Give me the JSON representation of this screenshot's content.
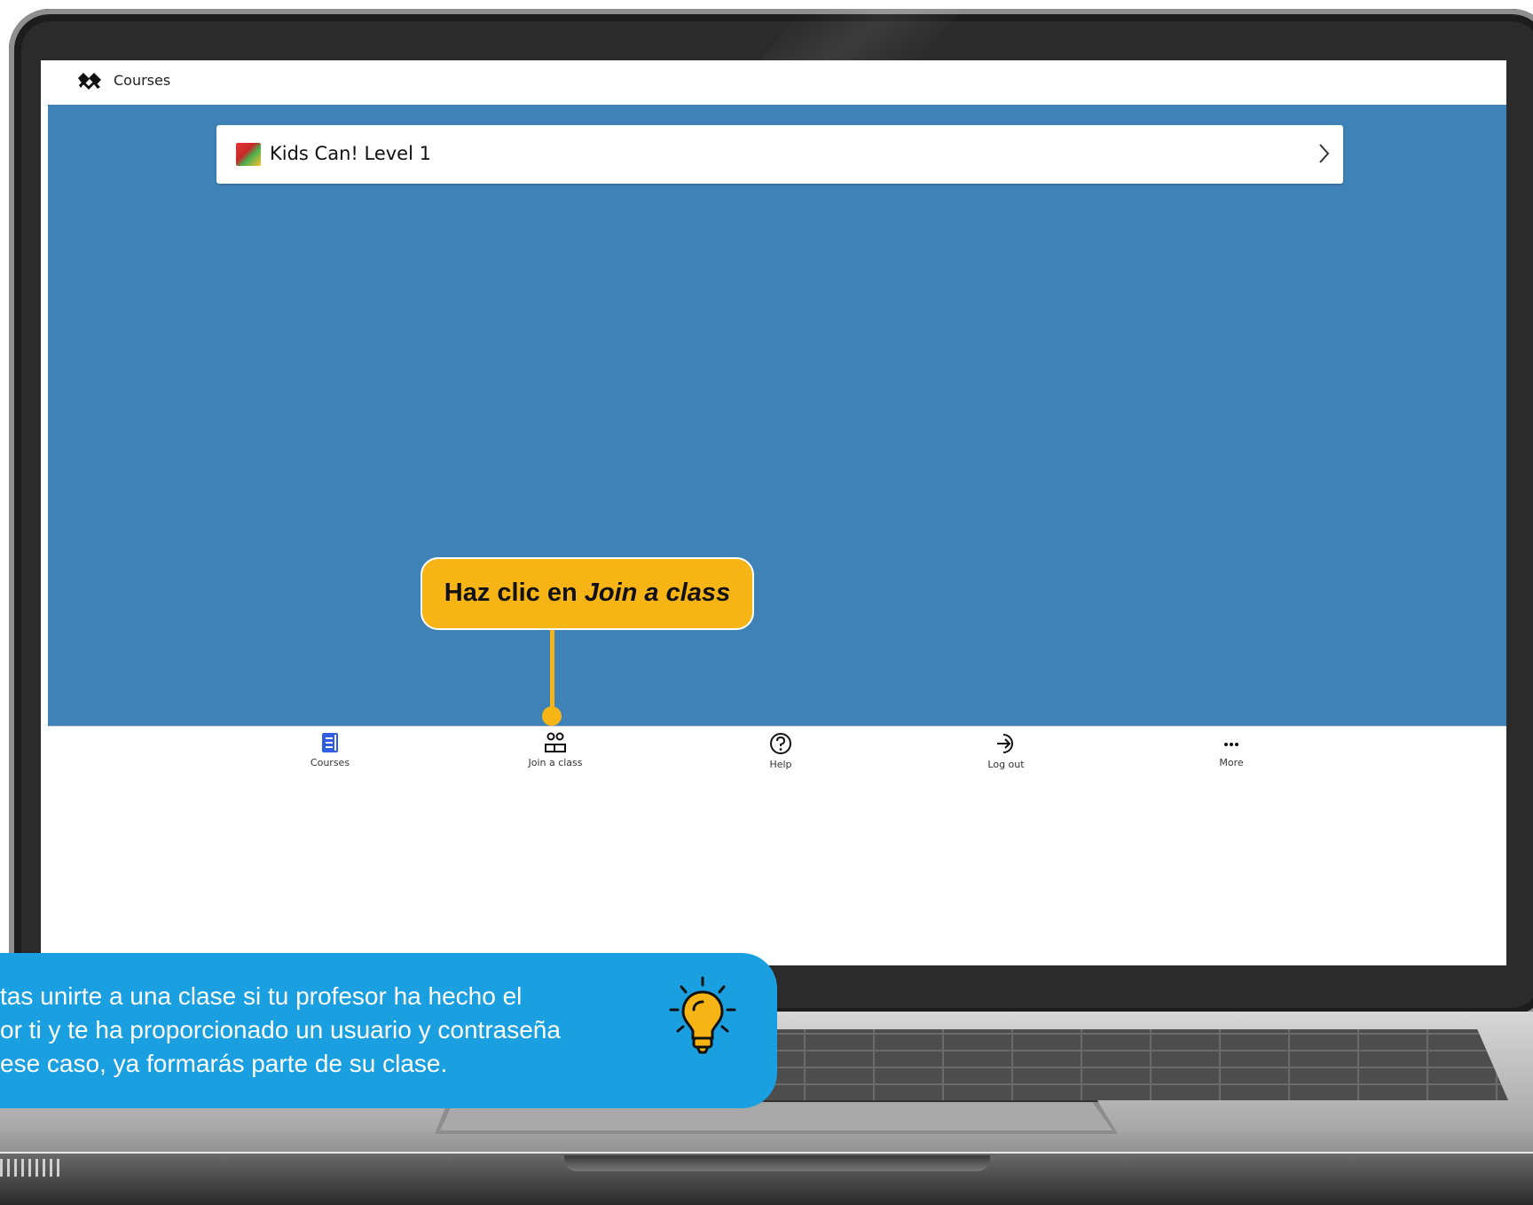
{
  "app": {
    "header_title": "Courses"
  },
  "course_card": {
    "title": "Kids Can! Level 1"
  },
  "bottom_nav": {
    "items": [
      {
        "label": "Courses",
        "icon": "book-icon",
        "active": true
      },
      {
        "label": "Join a class",
        "icon": "people-icon",
        "active": false
      },
      {
        "label": "Help",
        "icon": "help-icon",
        "active": false
      },
      {
        "label": "Log out",
        "icon": "logout-icon",
        "active": false
      },
      {
        "label": "More",
        "icon": "more-icon",
        "active": false
      }
    ]
  },
  "callout": {
    "prefix": "Haz clic en ",
    "emphasis": "Join a class"
  },
  "tip": {
    "text": "tas unirte a una clase si tu profesor ha hecho el\nor ti y te ha proporcionado un usuario y contraseña\n ese caso, ya formarás parte de su clase."
  },
  "colors": {
    "main_background": "#3f82b7",
    "callout": "#f7b515",
    "tip_panel": "#1aa0e0",
    "active_nav": "#2f5fe0"
  }
}
